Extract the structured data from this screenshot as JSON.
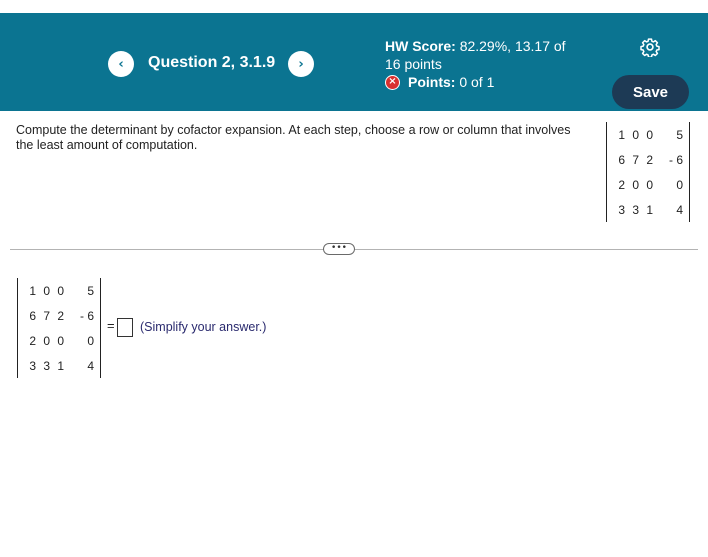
{
  "header": {
    "question_title": "Question 2, 3.1.9",
    "prev_symbol": "‹",
    "next_symbol": "›",
    "hw_score_label": "HW Score:",
    "hw_score_value": "82.29%, 13.17 of",
    "hw_score_value2": "16 points",
    "points_label": "Points:",
    "points_value": "0 of 1",
    "save_label": "Save",
    "x_symbol": "×"
  },
  "colors": {
    "header_bg": "#0b7491",
    "save_bg": "#1d3a55",
    "error_red": "#d9302f"
  },
  "instructions": "Compute the determinant by cofactor expansion. At each step, choose a row or column that involves the least amount of computation.",
  "matrix": {
    "rows": [
      [
        "1",
        "0",
        "0",
        "5"
      ],
      [
        "6",
        "7",
        "2",
        "- 6"
      ],
      [
        "2",
        "0",
        "0",
        "0"
      ],
      [
        "3",
        "3",
        "1",
        "4"
      ]
    ]
  },
  "answer": {
    "equals": "=",
    "value": "",
    "hint": "(Simplify your answer.)"
  },
  "more_label": "•••"
}
